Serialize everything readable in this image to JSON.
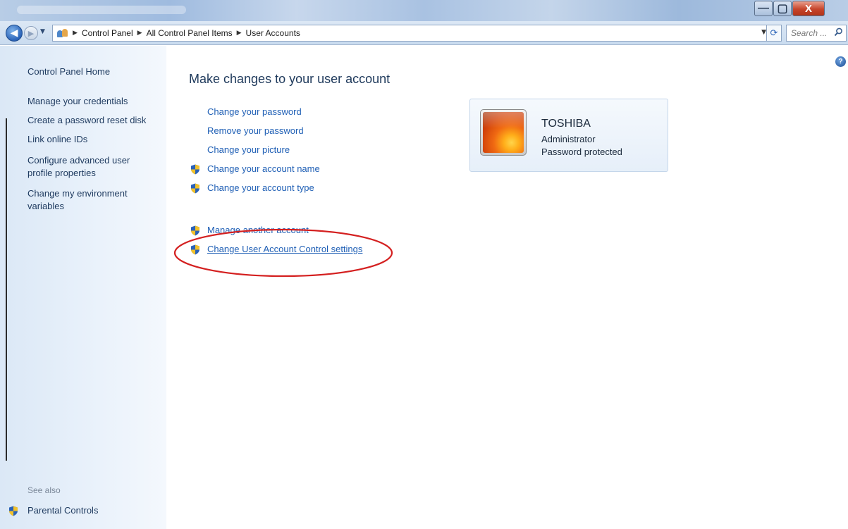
{
  "window": {
    "minimize_glyph": "—",
    "maximize_glyph": "▢",
    "close_glyph": "X"
  },
  "navigation": {
    "back_glyph": "◀",
    "forward_glyph": "▶",
    "recent_glyph": "▼",
    "breadcrumb": [
      "Control Panel",
      "All Control Panel Items",
      "User Accounts"
    ],
    "separator": "▶",
    "dropdown_glyph": "▼",
    "refresh_glyph": "⟳",
    "search_placeholder": "Search ...",
    "search_icon": "search-icon"
  },
  "sidebar": {
    "home": "Control Panel Home",
    "items": [
      "Manage your credentials",
      "Create a password reset disk",
      "Link online IDs",
      "Configure advanced user profile properties",
      "Change my environment variables"
    ],
    "see_also_label": "See also",
    "parental_controls": "Parental Controls"
  },
  "main": {
    "heading": "Make changes to your user account",
    "tasks": [
      "Change your password",
      "Remove your password",
      "Change your picture",
      "Change your account name",
      "Change your account type"
    ],
    "other_tasks": [
      "Manage another account",
      "Change User Account Control settings"
    ],
    "help_glyph": "?"
  },
  "account": {
    "name": "TOSHIBA",
    "role": "Administrator",
    "status": "Password protected"
  },
  "colors": {
    "link": "#1f5fb5",
    "annotation": "#d42020",
    "shield_blue": "#2a62b8",
    "shield_yellow": "#f2c22b"
  }
}
